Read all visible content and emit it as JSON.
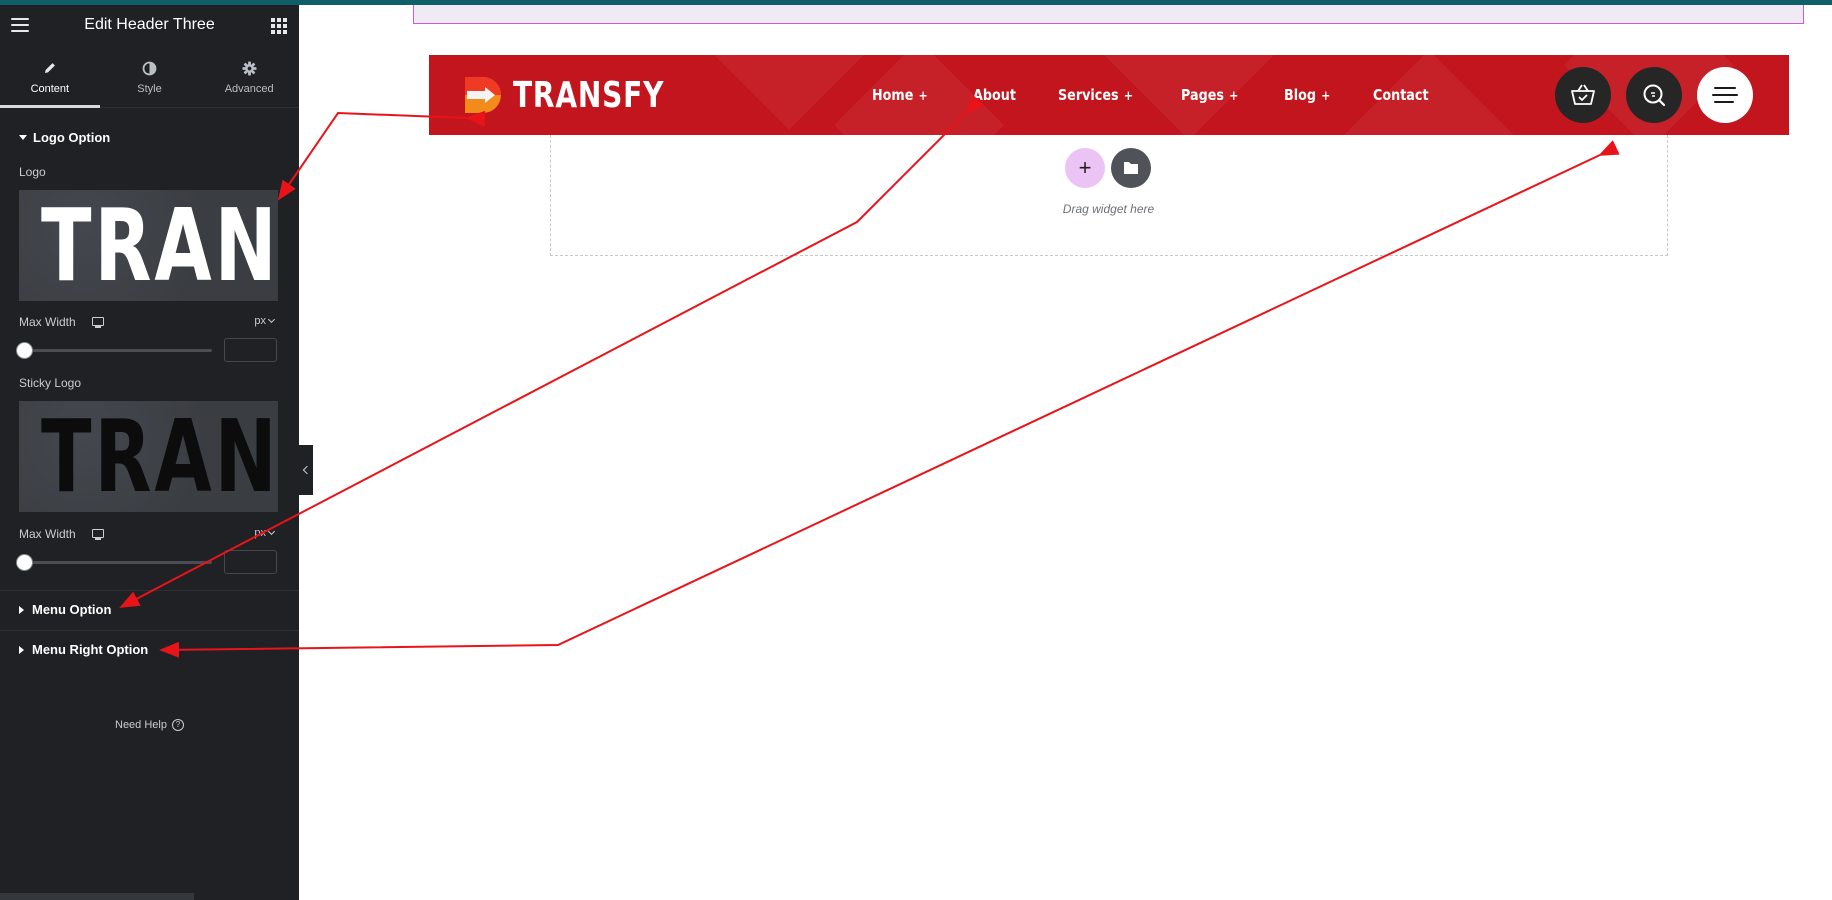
{
  "sidebar": {
    "title": "Edit Header Three",
    "tabs": [
      {
        "label": "Content",
        "icon": "pencil-icon",
        "active": true
      },
      {
        "label": "Style",
        "icon": "contrast-icon",
        "active": false
      },
      {
        "label": "Advanced",
        "icon": "gear-icon",
        "active": false
      }
    ],
    "logo_section": {
      "title": "Logo Option",
      "logo_label": "Logo",
      "logo_preview_text": "TRANSFY",
      "max_width_label": "Max Width",
      "unit": "px",
      "sticky_logo_label": "Sticky Logo",
      "sticky_preview_text": "TRANSFY",
      "max_width_label_2": "Max Width",
      "unit_2": "px"
    },
    "menu_option": "Menu Option",
    "menu_right_option": "Menu Right Option",
    "help": "Need Help"
  },
  "header": {
    "brand": "TRANSFY",
    "nav": [
      {
        "label": "Home",
        "has_submenu": true
      },
      {
        "label": "About",
        "has_submenu": false
      },
      {
        "label": "Services",
        "has_submenu": true
      },
      {
        "label": "Pages",
        "has_submenu": true
      },
      {
        "label": "Blog",
        "has_submenu": true
      },
      {
        "label": "Contact",
        "has_submenu": false
      }
    ],
    "submenu_symbol": "+",
    "buttons": [
      {
        "icon": "cart-icon"
      },
      {
        "icon": "search-icon"
      },
      {
        "icon": "menu-icon"
      }
    ],
    "colors": {
      "header_bg": "#c3151d",
      "dark_button": "#262626"
    }
  },
  "canvas": {
    "add_symbol": "+",
    "drag_text": "Drag widget here"
  },
  "annotation_color": "#e8141a"
}
